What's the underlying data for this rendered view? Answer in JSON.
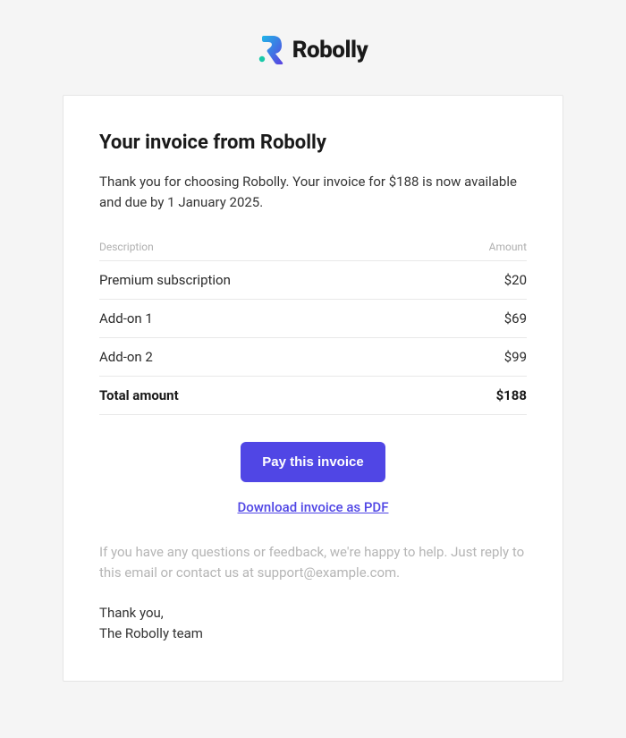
{
  "brand": {
    "name": "Robolly"
  },
  "header": {
    "title": "Your invoice from Robolly",
    "intro": "Thank you for choosing Robolly. Your invoice for $188 is now available and due by 1 January 2025."
  },
  "table": {
    "col_desc": "Description",
    "col_amount": "Amount",
    "items": [
      {
        "desc": "Premium subscription",
        "amount": "$20"
      },
      {
        "desc": "Add-on 1",
        "amount": "$69"
      },
      {
        "desc": "Add-on 2",
        "amount": "$99"
      }
    ],
    "total_label": "Total amount",
    "total_amount": "$188"
  },
  "actions": {
    "pay_label": "Pay this invoice",
    "download_label": "Download invoice as PDF"
  },
  "footer": {
    "help_text": "If you have any questions or feedback, we're happy to help. Just reply to this email or contact us at support@example.com.",
    "thanks": "Thank you,",
    "team": "The Robolly team"
  }
}
